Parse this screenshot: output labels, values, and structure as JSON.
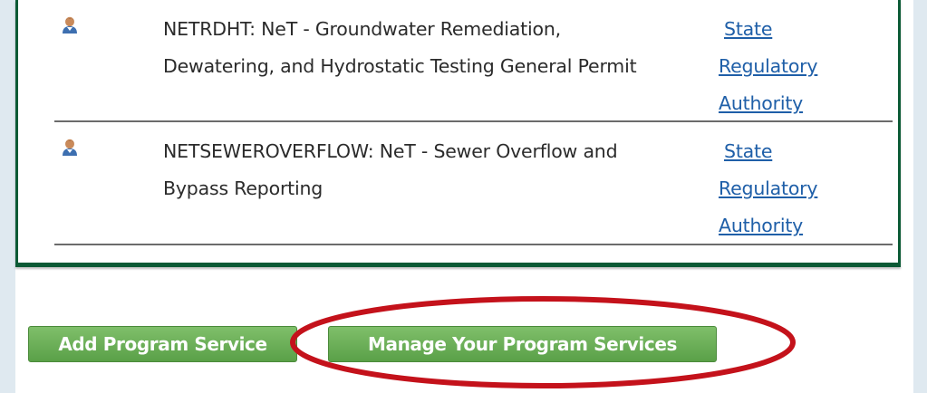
{
  "program_services": [
    {
      "description": "NETRDHT: NeT - Groundwater Remediation, Dewatering, and Hydrostatic Testing General Permit",
      "authority_lines": [
        "State",
        "Regulatory",
        "Authority"
      ],
      "icon": "user-icon"
    },
    {
      "description": "NETSEWEROVERFLOW: NeT - Sewer Overflow and Bypass Reporting",
      "authority_lines": [
        "State",
        "Regulatory",
        "Authority"
      ],
      "icon": "user-icon"
    }
  ],
  "buttons": {
    "add_label": "Add Program Service",
    "manage_label": "Manage Your Program Services"
  },
  "colors": {
    "panel_border": "#0b5a35",
    "button_green": "#6aaf56",
    "link_blue": "#1f5fa8",
    "highlight_red": "#c4121b"
  }
}
